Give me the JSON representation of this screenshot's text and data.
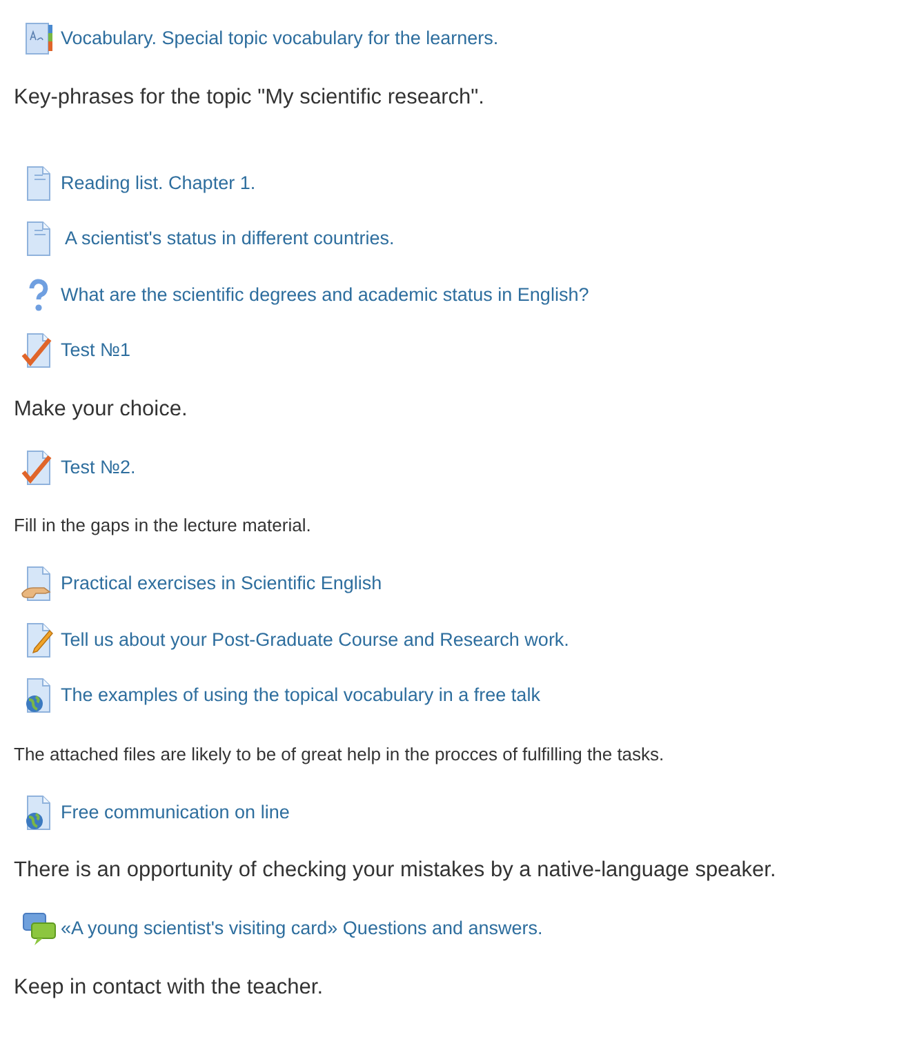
{
  "items": [
    {
      "kind": "glossary",
      "text": "Vocabulary. Special topic vocabulary for the learners."
    },
    {
      "kind": "note",
      "text": "Key-phrases for the topic \"My scientific research\"."
    },
    {
      "kind": "page",
      "text": "Reading list. Chapter 1."
    },
    {
      "kind": "page",
      "text": " A scientist's status in different countries."
    },
    {
      "kind": "question",
      "text": "What are the scientific degrees and academic status in English?"
    },
    {
      "kind": "quiz",
      "text": "Test №1"
    },
    {
      "kind": "note",
      "text": "Make your choice."
    },
    {
      "kind": "quiz",
      "text": "Test №2."
    },
    {
      "kind": "small_note",
      "text": "Fill in the gaps in  the lecture material."
    },
    {
      "kind": "workshop",
      "text": "Practical exercises in Scientific English"
    },
    {
      "kind": "assignment",
      "text": "Tell us about your Post-Graduate Course and Research work."
    },
    {
      "kind": "url",
      "text": "The examples of using the topical vocabulary in a free talk"
    },
    {
      "kind": "small_note",
      "text": "The attached files are likely to be of great help in the procces of fulfilling the tasks."
    },
    {
      "kind": "url",
      "text": "Free communication on line"
    },
    {
      "kind": "note",
      "text": "There is an opportunity of checking your mistakes by a native-language speaker."
    },
    {
      "kind": "forum",
      "text": "«A young scientist's visiting card» Questions and answers."
    },
    {
      "kind": "note",
      "text": "Keep in contact with the teacher."
    }
  ]
}
